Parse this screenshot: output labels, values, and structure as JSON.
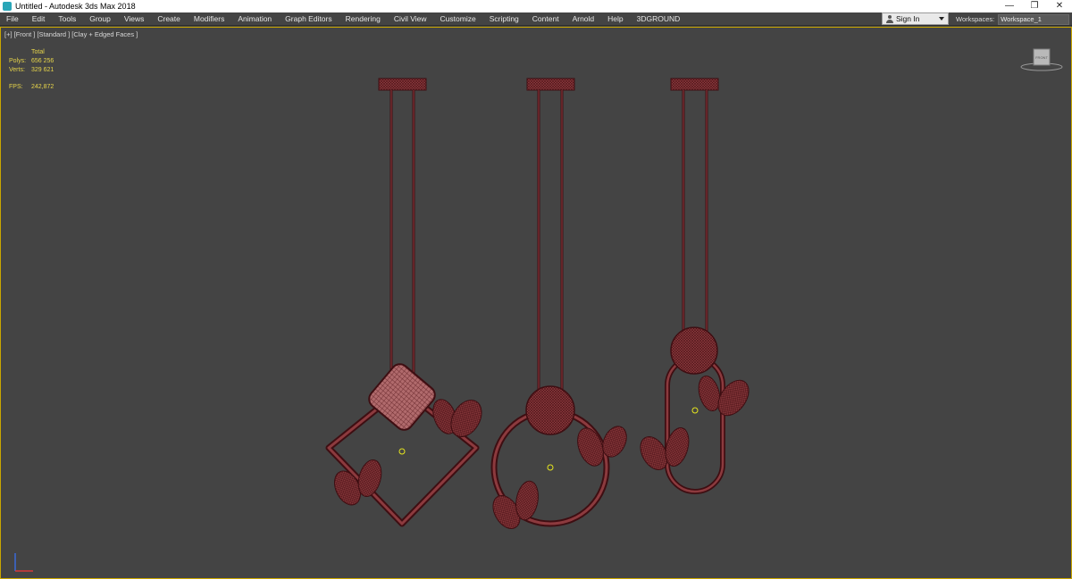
{
  "window": {
    "title": "Untitled - Autodesk 3ds Max 2018",
    "controls": [
      "—",
      "❐",
      "✕"
    ]
  },
  "menu": [
    "File",
    "Edit",
    "Tools",
    "Group",
    "Views",
    "Create",
    "Modifiers",
    "Animation",
    "Graph Editors",
    "Rendering",
    "Civil View",
    "Customize",
    "Scripting",
    "Content",
    "Arnold",
    "Help",
    "3DGROUND"
  ],
  "signin": {
    "label": "Sign In"
  },
  "workspaces": {
    "label": "Workspaces:",
    "value": "Workspace_1"
  },
  "viewport": {
    "label": "[+] [Front ] [Standard ] [Clay + Edged Faces ]",
    "stats": {
      "header": "Total",
      "polys_label": "Polys:",
      "polys_value": "656 256",
      "verts_label": "Verts:",
      "verts_value": "329 621",
      "fps_label": "FPS:",
      "fps_value": "242,872"
    },
    "viewcube_label": "FRONT"
  },
  "colors": {
    "viewport_bg": "#444444",
    "wire": "#5a1a1e",
    "wire_light": "#b86a6a",
    "stats": "#e6d44a",
    "active_border": "#c9a600"
  }
}
